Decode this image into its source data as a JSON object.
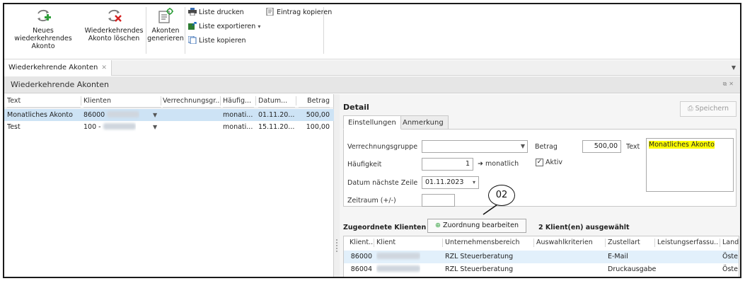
{
  "ribbon": {
    "new_account": "Neues wiederkehrendes Akonto",
    "delete_account": "Wiederkehrendes Akonto löschen",
    "generate": "Akonten generieren",
    "print_list": "Liste drucken",
    "export_list": "Liste exportieren",
    "copy_list": "Liste kopieren",
    "copy_entry": "Eintrag kopieren"
  },
  "tab": {
    "label": "Wiederkehrende Akonten"
  },
  "panel": {
    "title": "Wiederkehrende Akonten"
  },
  "grid": {
    "columns": [
      "Text",
      "Klienten",
      "Verrechnungsgr...",
      "Häufig...",
      "Datum...",
      "Betrag"
    ],
    "rows": [
      {
        "text": "Monatliches Akonto",
        "klient": "86000",
        "haeufig": "monati...",
        "datum": "01.11.20...",
        "betrag": "500,00"
      },
      {
        "text": "Test",
        "klient": "100 - ",
        "haeufig": "monati...",
        "datum": "15.11.20...",
        "betrag": "100,00"
      }
    ]
  },
  "detail": {
    "title": "Detail",
    "save": "Speichern",
    "tabs": [
      "Einstellungen",
      "Anmerkung"
    ],
    "labels": {
      "verrechnungsgruppe": "Verrechnungsgruppe",
      "haeufigkeit": "Häufigkeit",
      "datum": "Datum nächste Zeile",
      "zeitraum": "Zeitraum (+/-)",
      "betrag": "Betrag",
      "text": "Text",
      "aktiv": "Aktiv"
    },
    "values": {
      "verrechnungsgruppe": "",
      "haeufigkeit": "1",
      "haeufigkeit_unit": "monatlich",
      "datum": "01.11.2023",
      "zeitraum": "",
      "betrag": "500,00",
      "text": "Monatliches Akonto",
      "aktiv": true
    }
  },
  "zuordnung": {
    "title": "Zugeordnete Klienten",
    "button": "Zuordnung bearbeiten",
    "count": "2 Klient(en) ausgewählt"
  },
  "callout": {
    "label": "02"
  },
  "clients": {
    "columns": [
      "Klient...",
      "Klient",
      "Unternehmensbereich",
      "Auswahlkriterien",
      "Zustellart",
      "Leistungserfassu...",
      "Land"
    ],
    "rows": [
      {
        "nr": "86000",
        "bereich": "RZL Steuerberatung",
        "zustellart": "E-Mail",
        "land": "Öste"
      },
      {
        "nr": "86004",
        "bereich": "RZL Steuerberatung",
        "zustellart": "Druckausgabe",
        "land": "Öste"
      }
    ]
  },
  "colors": {
    "selection": "#cde3f5",
    "highlight": "#ffff00",
    "panel_bar": "#e6e6e6"
  }
}
